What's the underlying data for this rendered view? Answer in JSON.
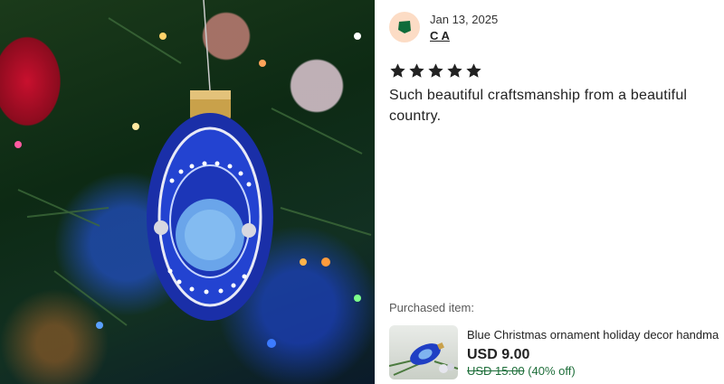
{
  "review": {
    "date": "Jan 13, 2025",
    "reviewer": "C A",
    "rating": 5,
    "max_rating": 5,
    "text": "Such beautiful craftsmanship from a beautiful country."
  },
  "purchase": {
    "label": "Purchased item:",
    "title": "Blue Christmas ornament holiday decor handma",
    "price": "USD 9.00",
    "original_price": "USD 15.00",
    "discount": "(40% off)"
  },
  "colors": {
    "star": "#222222",
    "avatar_bg": "#fcdcc5",
    "avatar_icon": "#0e6b3a",
    "discount_text": "#1e6e3a"
  },
  "icons": {
    "avatar": "pentagon-avatar-icon",
    "star": "star-icon"
  }
}
